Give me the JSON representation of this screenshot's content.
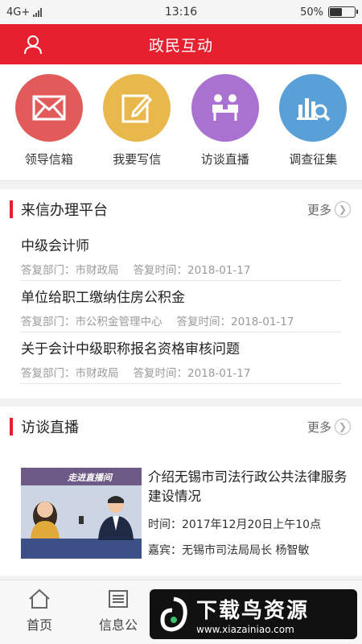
{
  "status": {
    "network": "4G+",
    "time": "13:16",
    "battery_text": "50%",
    "battery_level": 0.5
  },
  "header": {
    "title": "政民互动",
    "user_icon": "user-icon"
  },
  "quick": [
    {
      "label": "领导信箱",
      "icon": "mail-icon",
      "color": "#e25b5b"
    },
    {
      "label": "我要写信",
      "icon": "pencil-icon",
      "color": "#e8b84d"
    },
    {
      "label": "访谈直播",
      "icon": "interview-icon",
      "color": "#a972d0"
    },
    {
      "label": "调查征集",
      "icon": "chart-search-icon",
      "color": "#5aa0d8"
    }
  ],
  "letters_section": {
    "title": "来信办理平台",
    "more": "更多",
    "items": [
      {
        "title": "中级会计师",
        "dept": "答复部门：市财政局",
        "time": "答复时间：2018-01-17"
      },
      {
        "title": "单位给职工缴纳住房公积金",
        "dept": "答复部门：市公积金管理中心",
        "time": "答复时间：2018-01-17"
      },
      {
        "title": "关于会计中级职称报名资格审核问题",
        "dept": "答复部门：市财政局",
        "time": "答复时间：2018-01-17"
      }
    ]
  },
  "live_section": {
    "title": "访谈直播",
    "more": "更多",
    "item": {
      "title": "介绍无锡市司法行政公共法律服务建设情况",
      "time": "时间：2017年12月20日上午10点",
      "guest": "嘉宾：无锡市司法局局长 杨智敏",
      "banner": "走进直播间"
    }
  },
  "tabs": [
    {
      "label": "首页",
      "icon": "home-icon"
    },
    {
      "label": "信息公",
      "icon": "info-icon"
    }
  ],
  "watermark": {
    "main": "下载鸟资源",
    "url": "www.xiazainiao.com"
  },
  "colors": {
    "brand_red": "#e5212f"
  }
}
